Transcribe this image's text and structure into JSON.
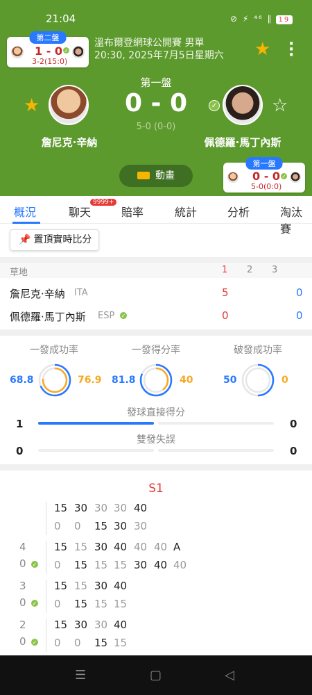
{
  "status_bar": {
    "time": "21:04",
    "icons": "⊘ ⚡ ⁴⁶ ∥",
    "battery": "19"
  },
  "set2_card": {
    "tag": "第二盤",
    "score": "1 - 0",
    "sub": "3-2(15:0)"
  },
  "tournament": {
    "name": "溫布爾登網球公開賽 男單",
    "datetime": "20:30, 2025年7月5日星期六"
  },
  "match": {
    "set_label": "第一盤",
    "score": "0 - 0",
    "sub_score": "5-0 (0-0)",
    "player1": "詹尼克·辛納",
    "player2": "佩德羅·馬丁內斯"
  },
  "animation_button": "動畫",
  "set1_card": {
    "tag": "第一盤",
    "score": "0 - 0",
    "sub": "5-0(0:0)"
  },
  "tabs": [
    {
      "label": "概況"
    },
    {
      "label": "聊天"
    },
    {
      "label": "賠率"
    },
    {
      "label": "統計"
    },
    {
      "label": "分析"
    },
    {
      "label": "淘汰賽"
    }
  ],
  "chat_badge": "9999+",
  "pin_button": "置頂實時比分",
  "scoreboard": {
    "surface": "草地",
    "sets": [
      "1",
      "2",
      "3"
    ],
    "rows": [
      {
        "name": "詹尼克·辛納",
        "country": "ITA",
        "set1": "5",
        "total": "0"
      },
      {
        "name": "佩德羅·馬丁內斯",
        "country": "ESP",
        "set1": "0",
        "total": "0"
      }
    ]
  },
  "stats": {
    "first_serve_pct": {
      "label": "一發成功率",
      "p1": "68.8",
      "p2": "76.9",
      "p1_frac": 0.688,
      "p2_frac": 0.769
    },
    "first_serve_won": {
      "label": "一發得分率",
      "p1": "81.8",
      "p2": "40",
      "p1_frac": 0.818,
      "p2_frac": 0.4
    },
    "break_points": {
      "label": "破發成功率",
      "p1": "50",
      "p2": "0",
      "p1_frac": 0.5,
      "p2_frac": 0.0
    },
    "aces": {
      "label": "發球直接得分",
      "p1": "1",
      "p2": "0",
      "p1_frac": 1.0,
      "p2_frac": 0.0
    },
    "double_faults": {
      "label": "雙發失誤",
      "p1": "0",
      "p2": "0",
      "p1_frac": 0.0,
      "p2_frac": 0.0
    }
  },
  "pbp": {
    "set_title": "S1",
    "games": [
      {
        "num": "",
        "top": [
          "15",
          "30",
          "30",
          "30",
          "40"
        ],
        "bot": [
          "0",
          "0",
          "15",
          "30",
          "30"
        ]
      },
      {
        "num": "4",
        "p2num": "0",
        "top": [
          "15",
          "15",
          "30",
          "40",
          "40",
          "40",
          "A"
        ],
        "bot": [
          "0",
          "15",
          "15",
          "15",
          "30",
          "40",
          "40"
        ]
      },
      {
        "num": "3",
        "p2num": "0",
        "top": [
          "15",
          "15",
          "30",
          "40"
        ],
        "bot": [
          "0",
          "15",
          "15",
          "15"
        ]
      },
      {
        "num": "2",
        "p2num": "0",
        "top": [
          "15",
          "30",
          "30",
          "40"
        ],
        "bot": [
          "0",
          "0",
          "15",
          "15"
        ]
      }
    ]
  },
  "colors": {
    "header_green": "#5d9a2e",
    "accent_blue": "#2979ff",
    "accent_orange": "#f7a823",
    "score_red": "#e53935"
  }
}
